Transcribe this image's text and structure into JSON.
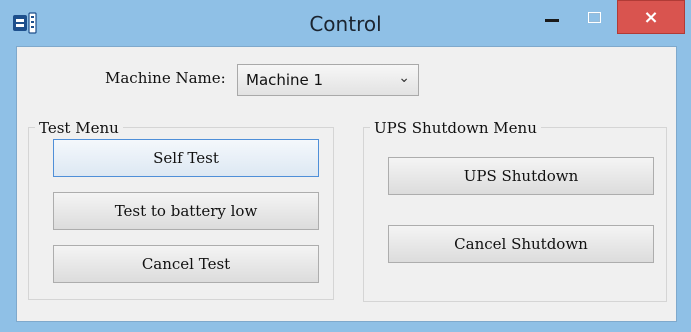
{
  "window": {
    "title": "Control",
    "close_glyph": "×",
    "icons": {
      "app": "app-icon",
      "minimize": "minimize-icon",
      "maximize": "maximize-icon",
      "close": "close-icon"
    },
    "close_color": "#d9544f",
    "titlebar_color": "#8fc0e6"
  },
  "machine": {
    "label": "Machine Name:",
    "selected": "Machine 1",
    "chevron": "⌄"
  },
  "test_menu": {
    "title": "Test Menu",
    "buttons": {
      "self_test": "Self Test",
      "test_to_battery_low": "Test to battery low",
      "cancel_test": "Cancel Test"
    }
  },
  "ups_menu": {
    "title": "UPS Shutdown Menu",
    "buttons": {
      "ups_shutdown": "UPS Shutdown",
      "cancel_shutdown": "Cancel Shutdown"
    }
  }
}
